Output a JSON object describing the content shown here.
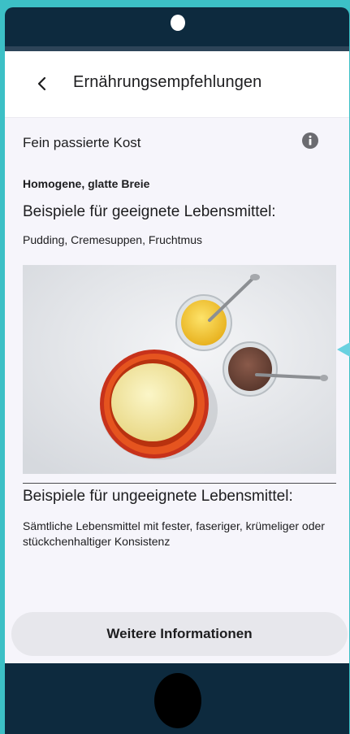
{
  "navbar": {
    "back_icon": "chevron-left-icon",
    "title": "Ernährungsempfehlungen"
  },
  "content": {
    "section_title": "Fein passierte Kost",
    "info_icon": "info-circle-icon",
    "subheading": "Homogene, glatte Breie",
    "suitable": {
      "heading": "Beispiele für geeignete Lebensmittel:",
      "text": "Pudding, Cremesuppen, Fruchtmus"
    },
    "image": {
      "subject": "bowl of pudding, glass of fruit puree, glass of chocolate mousse with spoons"
    },
    "unsuitable": {
      "heading": "Beispiele für ungeeignete Lebensmittel:",
      "text": "Sämtliche Lebensmittel mit fester, faseriger, krümeliger oder stückchenhaltiger Konsistenz"
    }
  },
  "footer": {
    "button_label": "Weitere Informationen"
  },
  "colors": {
    "device_frame": "#0d2a3e",
    "background": "#3cc0c6",
    "screen": "#f6f5fb",
    "button": "#e7e7ec"
  }
}
